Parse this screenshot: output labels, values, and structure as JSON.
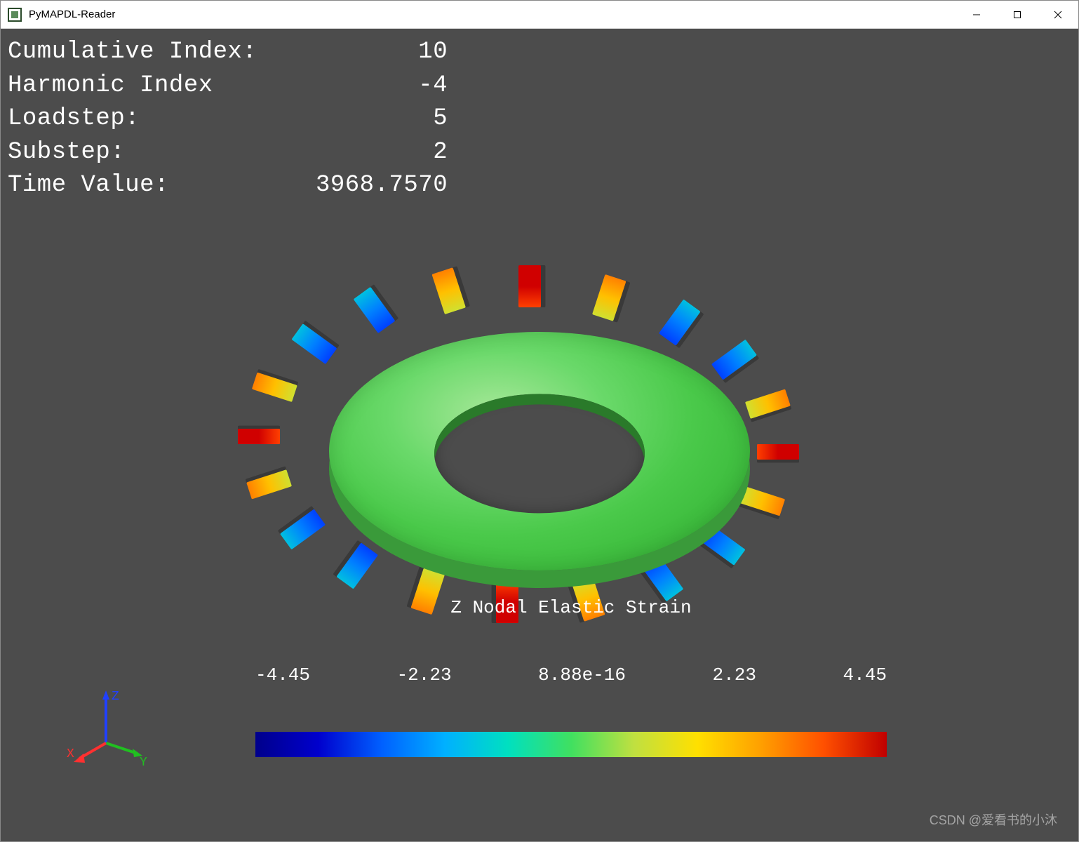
{
  "window": {
    "title": "PyMAPDL-Reader"
  },
  "overlay": {
    "rows": [
      {
        "label": "Cumulative Index:",
        "value": "10"
      },
      {
        "label": "Harmonic Index",
        "value": "-4"
      },
      {
        "label": "Loadstep:",
        "value": "5"
      },
      {
        "label": "Substep:",
        "value": "2"
      },
      {
        "label": "Time Value:",
        "value": "3968.7570"
      }
    ]
  },
  "axes": {
    "x": "X",
    "y": "Y",
    "z": "Z"
  },
  "legend": {
    "title": "Z Nodal Elastic Strain",
    "ticks": [
      "-4.45",
      "-2.23",
      "8.88e-16",
      "2.23",
      "4.45"
    ]
  },
  "watermark": "CSDN @爱看书的小沐",
  "chart_data": {
    "type": "scalar-field-colorbar",
    "title": "Z Nodal Elastic Strain",
    "range": [
      -4.45,
      4.45
    ],
    "ticks": [
      -4.45,
      -2.23,
      8.88e-16,
      2.23,
      4.45
    ],
    "metadata": {
      "cumulative_index": 10,
      "harmonic_index": -4,
      "loadstep": 5,
      "substep": 2,
      "time_value": 3968.757
    }
  }
}
